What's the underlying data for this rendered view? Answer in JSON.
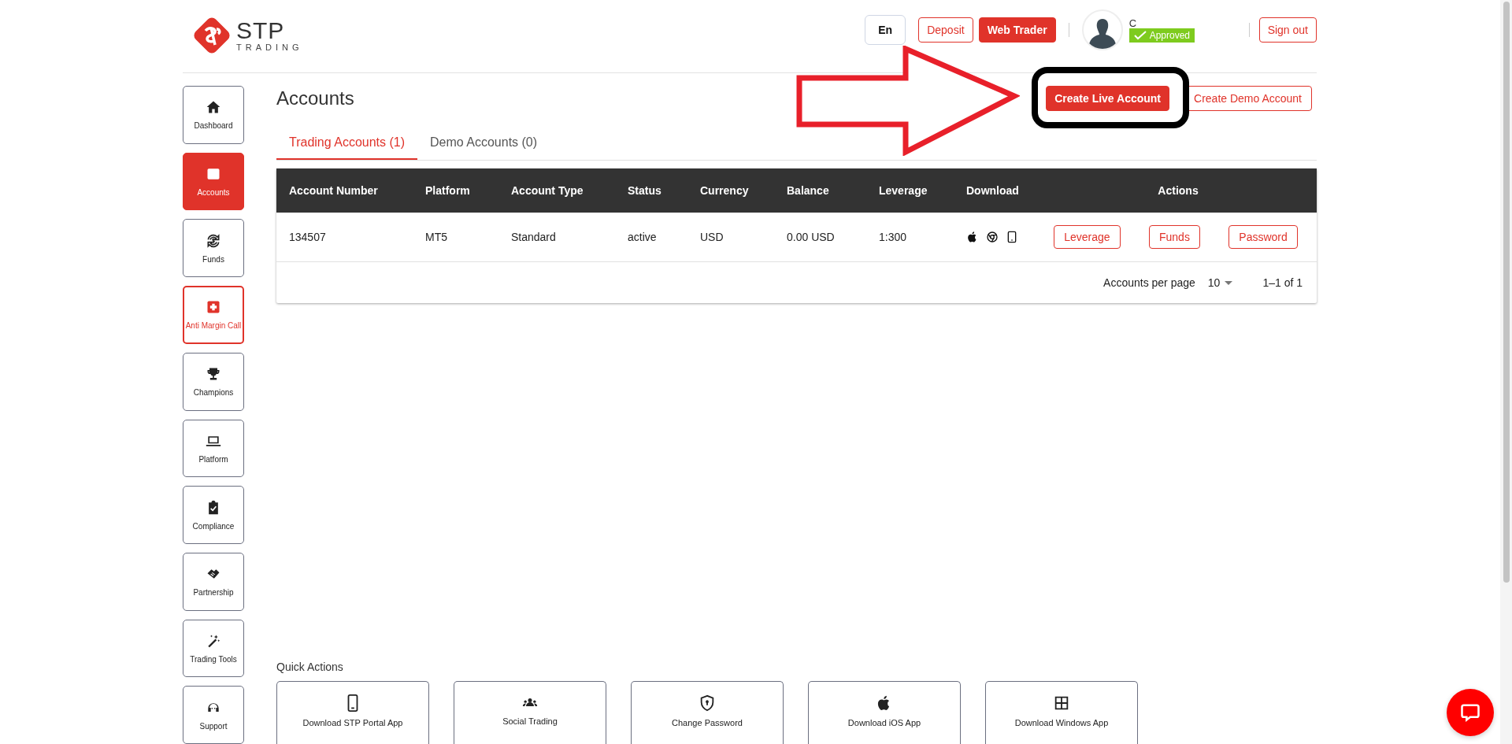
{
  "logo": {
    "name": "STP",
    "tagline": "TRADING"
  },
  "header": {
    "language": "En",
    "buttons": [
      {
        "label": "Deposit",
        "kind": "outline"
      },
      {
        "label": "Web Trader",
        "kind": "filled"
      }
    ],
    "user": {
      "name": "C",
      "status": "Approved"
    },
    "sign_out": "Sign out"
  },
  "sidebar": {
    "items": [
      {
        "label": "Dashboard",
        "selected": false,
        "kind": "normal"
      },
      {
        "label": "Accounts",
        "selected": true,
        "kind": "normal"
      },
      {
        "label": "Funds",
        "selected": false,
        "kind": "normal"
      },
      {
        "label": "Anti Margin Call",
        "selected": false,
        "kind": "alert"
      },
      {
        "label": "Champions",
        "selected": false,
        "kind": "normal"
      },
      {
        "label": "Platform",
        "selected": false,
        "kind": "normal"
      },
      {
        "label": "Compliance",
        "selected": false,
        "kind": "normal"
      },
      {
        "label": "Partnership",
        "selected": false,
        "kind": "normal"
      },
      {
        "label": "Trading Tools",
        "selected": false,
        "kind": "normal"
      },
      {
        "label": "Support",
        "selected": false,
        "kind": "normal"
      }
    ]
  },
  "page": {
    "title": "Accounts",
    "actions": [
      {
        "label": "Create Live Account",
        "kind": "filled"
      },
      {
        "label": "Create Demo Account",
        "kind": "outline"
      }
    ]
  },
  "tabs": [
    {
      "label": "Trading Accounts (1)",
      "selected": true
    },
    {
      "label": "Demo Accounts (0)",
      "selected": false
    }
  ],
  "table": {
    "columns": [
      "Account Number",
      "Platform",
      "Account Type",
      "Status",
      "Currency",
      "Balance",
      "Leverage",
      "Download",
      "Actions"
    ],
    "rows": [
      {
        "cells": [
          "134507",
          "MT5",
          "Standard",
          "active",
          "USD",
          "0.00 USD",
          "1:300"
        ],
        "actions": [
          "Leverage",
          "Funds",
          "Password"
        ]
      }
    ],
    "pagination": {
      "label": "Accounts per page",
      "per_page": "10",
      "range": "1–1 of 1"
    }
  },
  "quick_actions": {
    "title": "Quick Actions",
    "items": [
      "Download STP Portal App",
      "Social Trading",
      "Change Password",
      "Download iOS App",
      "Download Windows App"
    ]
  }
}
